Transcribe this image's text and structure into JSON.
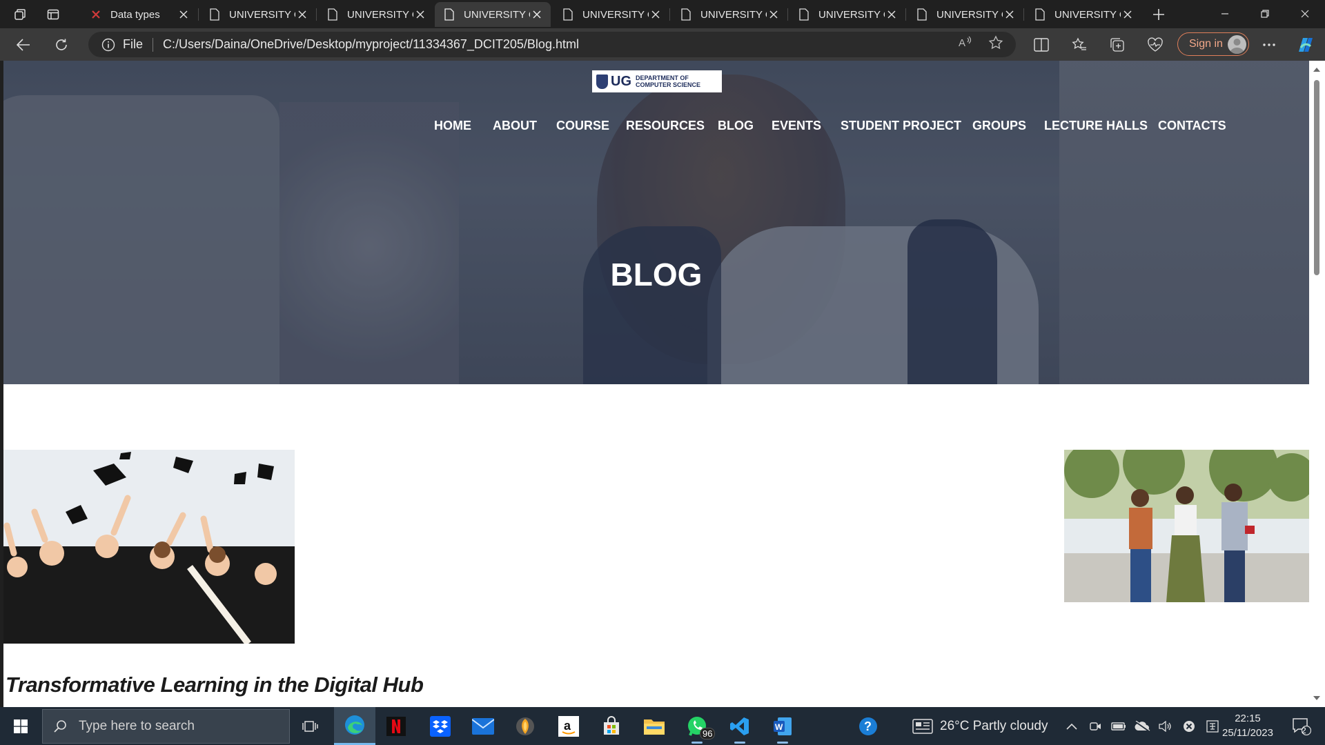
{
  "browser": {
    "tabs": [
      {
        "title": "Data types",
        "active": false,
        "icon": "red-x-icon"
      },
      {
        "title": "UNIVERSITY OF GHANA",
        "active": false,
        "icon": "document-icon"
      },
      {
        "title": "UNIVERSITY OF GHANA",
        "active": false,
        "icon": "document-icon"
      },
      {
        "title": "UNIVERSITY OF GHANA",
        "active": true,
        "icon": "document-icon"
      },
      {
        "title": "UNIVERSITY OF GHANA",
        "active": false,
        "icon": "document-icon"
      },
      {
        "title": "UNIVERSITY OF GHANA",
        "active": false,
        "icon": "document-icon"
      },
      {
        "title": "UNIVERSITY OF GHANA",
        "active": false,
        "icon": "document-icon"
      },
      {
        "title": "UNIVERSITY OF GHANA",
        "active": false,
        "icon": "document-icon"
      },
      {
        "title": "UNIVERSITY OF GHANA",
        "active": false,
        "icon": "document-icon"
      }
    ],
    "address": {
      "scheme_label": "File",
      "url": "C:/Users/Daina/OneDrive/Desktop/myproject/11334367_DCIT205/Blog.html"
    },
    "signin_label": "Sign in"
  },
  "site": {
    "logo": {
      "mark": "UG",
      "line1": "DEPARTMENT OF",
      "line2": "COMPUTER SCIENCE"
    },
    "nav": [
      "HOME",
      "ABOUT",
      "COURSE",
      "RESOURCES",
      "BLOG",
      "EVENTS",
      "STUDENT PROJECT",
      "GROUPS",
      "LECTURE HALLS",
      "CONTACTS"
    ],
    "hero_title": "BLOG",
    "article_title": "Transformative Learning in the Digital Hub"
  },
  "taskbar": {
    "search_placeholder": "Type here to search",
    "whatsapp_badge": "96",
    "weather": "26°C  Partly cloudy",
    "time": "22:15",
    "date": "25/11/2023",
    "notifications": "2"
  },
  "colors": {
    "accent_edge": "#0078d4",
    "signin_outline": "#e07f5a",
    "taskbar": "#1f2a36"
  }
}
